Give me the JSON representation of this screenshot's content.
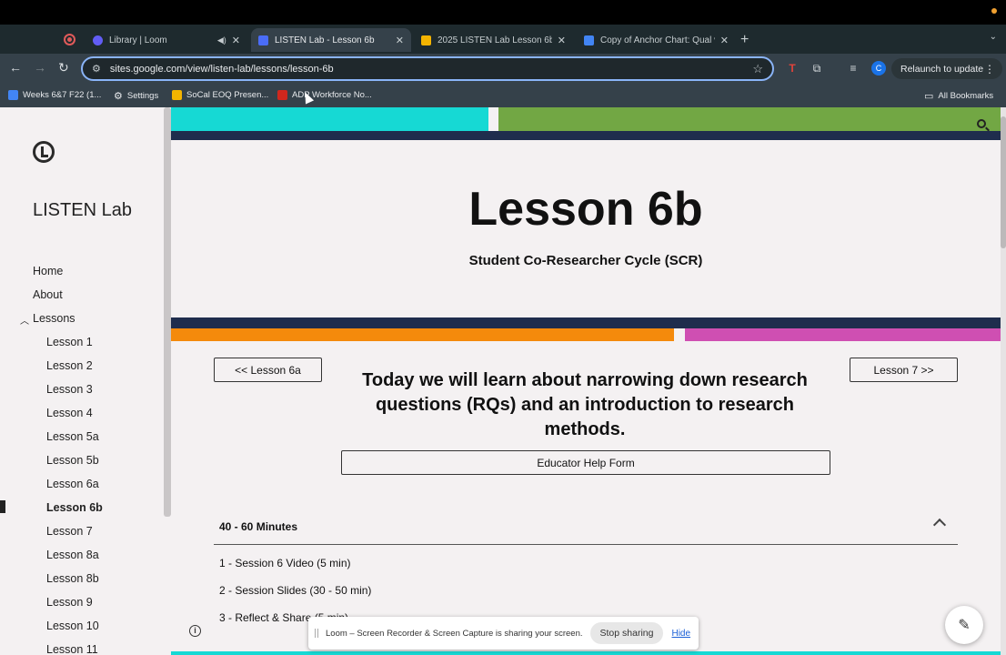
{
  "browser": {
    "tabs": [
      {
        "title": "Library | Loom",
        "active": false,
        "icon": "loom-icon",
        "color": "#625df5"
      },
      {
        "title": "LISTEN Lab - Lesson 6b",
        "active": true,
        "icon": "google-sites-icon",
        "color": "#4a6cf7"
      },
      {
        "title": "2025 LISTEN Lab Lesson 6b",
        "active": false,
        "icon": "google-slides-icon",
        "color": "#f4b400"
      },
      {
        "title": "Copy of Anchor Chart: Qual v",
        "active": false,
        "icon": "google-docs-icon",
        "color": "#4285f4"
      }
    ],
    "url": "sites.google.com/view/listen-lab/lessons/lesson-6b",
    "profile_initial": "C",
    "relaunch_label": "Relaunch to update",
    "bookmarks": [
      {
        "label": "Weeks 6&7 F22 (1...",
        "icon": "docs-icon",
        "color": "#4285f4"
      },
      {
        "label": "Settings",
        "icon": "gear-icon",
        "color": "#e8eaed"
      },
      {
        "label": "SoCal EOQ Presen...",
        "icon": "slides-icon",
        "color": "#f4b400"
      },
      {
        "label": "ADP Workforce No...",
        "icon": "adp-icon",
        "color": "#d0271d"
      }
    ],
    "all_bookmarks_label": "All Bookmarks"
  },
  "sidebar": {
    "site_name": "LISTEN Lab",
    "nav": [
      {
        "label": "Home"
      },
      {
        "label": "About"
      },
      {
        "label": "Lessons"
      },
      {
        "label": "Lesson 1"
      },
      {
        "label": "Lesson 2"
      },
      {
        "label": "Lesson 3"
      },
      {
        "label": "Lesson 4"
      },
      {
        "label": "Lesson 5a"
      },
      {
        "label": "Lesson 5b"
      },
      {
        "label": "Lesson 6a"
      },
      {
        "label": "Lesson 6b"
      },
      {
        "label": "Lesson 7"
      },
      {
        "label": "Lesson 8a"
      },
      {
        "label": "Lesson 8b"
      },
      {
        "label": "Lesson 9"
      },
      {
        "label": "Lesson 10"
      },
      {
        "label": "Lesson 11"
      }
    ],
    "current": "Lesson 6b"
  },
  "main": {
    "title": "Lesson 6b",
    "subtitle": "Student Co-Researcher Cycle (SCR)",
    "prev_button": "<< Lesson 6a",
    "next_button": "Lesson 7 >>",
    "intro": "Today we will learn about narrowing down research questions (RQs) and an introduction to research methods.",
    "help_button": "Educator Help Form",
    "accordion": {
      "heading": "40 - 60 Minutes",
      "items": [
        "1 - Session 6 Video (5 min)",
        "2 - Session Slides (30 - 50 min)",
        "3 - Reflect & Share (5 min)"
      ]
    },
    "colors": {
      "teal": "#16d9d4",
      "green": "#72a744",
      "navy": "#1f2d4d",
      "orange": "#f48a0c",
      "pink": "#cf4fb2"
    }
  },
  "loom": {
    "message": "Loom – Screen Recorder & Screen Capture is sharing your screen.",
    "stop_label": "Stop sharing",
    "hide_label": "Hide"
  }
}
